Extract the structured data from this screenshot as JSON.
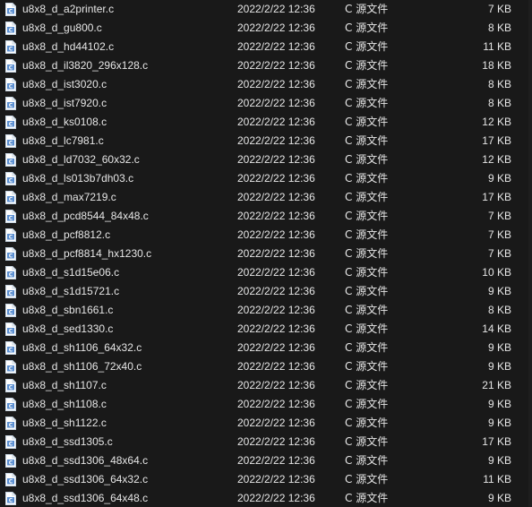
{
  "colors": {
    "background": "#191919",
    "text": "#e6e6e6",
    "icon_outline": "#c9d6e2",
    "icon_fill": "#ffffff",
    "icon_accent": "#5b8fd1"
  },
  "icons": {
    "file": "c-source-file-icon"
  },
  "files": [
    {
      "name": "u8x8_d_a2printer.c",
      "date": "2022/2/22 12:36",
      "type": "C 源文件",
      "size": "7 KB"
    },
    {
      "name": "u8x8_d_gu800.c",
      "date": "2022/2/22 12:36",
      "type": "C 源文件",
      "size": "8 KB"
    },
    {
      "name": "u8x8_d_hd44102.c",
      "date": "2022/2/22 12:36",
      "type": "C 源文件",
      "size": "11 KB"
    },
    {
      "name": "u8x8_d_il3820_296x128.c",
      "date": "2022/2/22 12:36",
      "type": "C 源文件",
      "size": "18 KB"
    },
    {
      "name": "u8x8_d_ist3020.c",
      "date": "2022/2/22 12:36",
      "type": "C 源文件",
      "size": "8 KB"
    },
    {
      "name": "u8x8_d_ist7920.c",
      "date": "2022/2/22 12:36",
      "type": "C 源文件",
      "size": "8 KB"
    },
    {
      "name": "u8x8_d_ks0108.c",
      "date": "2022/2/22 12:36",
      "type": "C 源文件",
      "size": "12 KB"
    },
    {
      "name": "u8x8_d_lc7981.c",
      "date": "2022/2/22 12:36",
      "type": "C 源文件",
      "size": "17 KB"
    },
    {
      "name": "u8x8_d_ld7032_60x32.c",
      "date": "2022/2/22 12:36",
      "type": "C 源文件",
      "size": "12 KB"
    },
    {
      "name": "u8x8_d_ls013b7dh03.c",
      "date": "2022/2/22 12:36",
      "type": "C 源文件",
      "size": "9 KB"
    },
    {
      "name": "u8x8_d_max7219.c",
      "date": "2022/2/22 12:36",
      "type": "C 源文件",
      "size": "17 KB"
    },
    {
      "name": "u8x8_d_pcd8544_84x48.c",
      "date": "2022/2/22 12:36",
      "type": "C 源文件",
      "size": "7 KB"
    },
    {
      "name": "u8x8_d_pcf8812.c",
      "date": "2022/2/22 12:36",
      "type": "C 源文件",
      "size": "7 KB"
    },
    {
      "name": "u8x8_d_pcf8814_hx1230.c",
      "date": "2022/2/22 12:36",
      "type": "C 源文件",
      "size": "7 KB"
    },
    {
      "name": "u8x8_d_s1d15e06.c",
      "date": "2022/2/22 12:36",
      "type": "C 源文件",
      "size": "10 KB"
    },
    {
      "name": "u8x8_d_s1d15721.c",
      "date": "2022/2/22 12:36",
      "type": "C 源文件",
      "size": "9 KB"
    },
    {
      "name": "u8x8_d_sbn1661.c",
      "date": "2022/2/22 12:36",
      "type": "C 源文件",
      "size": "8 KB"
    },
    {
      "name": "u8x8_d_sed1330.c",
      "date": "2022/2/22 12:36",
      "type": "C 源文件",
      "size": "14 KB"
    },
    {
      "name": "u8x8_d_sh1106_64x32.c",
      "date": "2022/2/22 12:36",
      "type": "C 源文件",
      "size": "9 KB"
    },
    {
      "name": "u8x8_d_sh1106_72x40.c",
      "date": "2022/2/22 12:36",
      "type": "C 源文件",
      "size": "9 KB"
    },
    {
      "name": "u8x8_d_sh1107.c",
      "date": "2022/2/22 12:36",
      "type": "C 源文件",
      "size": "21 KB"
    },
    {
      "name": "u8x8_d_sh1108.c",
      "date": "2022/2/22 12:36",
      "type": "C 源文件",
      "size": "9 KB"
    },
    {
      "name": "u8x8_d_sh1122.c",
      "date": "2022/2/22 12:36",
      "type": "C 源文件",
      "size": "9 KB"
    },
    {
      "name": "u8x8_d_ssd1305.c",
      "date": "2022/2/22 12:36",
      "type": "C 源文件",
      "size": "17 KB"
    },
    {
      "name": "u8x8_d_ssd1306_48x64.c",
      "date": "2022/2/22 12:36",
      "type": "C 源文件",
      "size": "9 KB"
    },
    {
      "name": "u8x8_d_ssd1306_64x32.c",
      "date": "2022/2/22 12:36",
      "type": "C 源文件",
      "size": "11 KB"
    },
    {
      "name": "u8x8_d_ssd1306_64x48.c",
      "date": "2022/2/22 12:36",
      "type": "C 源文件",
      "size": "9 KB"
    }
  ]
}
